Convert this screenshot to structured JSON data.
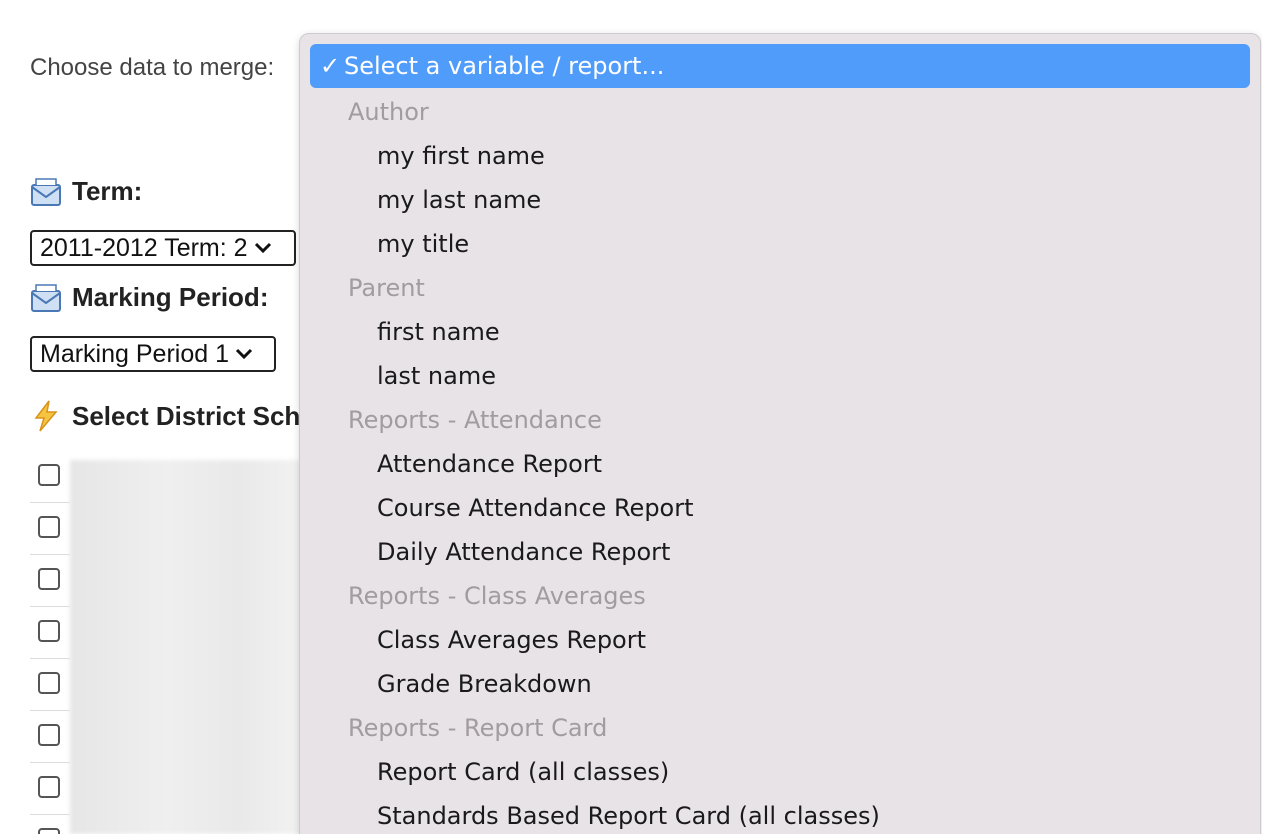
{
  "merge": {
    "label": "Choose data to merge:"
  },
  "term": {
    "heading": "Term:",
    "selected": "2011-2012 Term: 2"
  },
  "marking_period": {
    "heading": "Marking Period:",
    "selected": "Marking Period 1"
  },
  "district": {
    "heading": "Select District School"
  },
  "dropdown": {
    "selected": "Select a variable / report...",
    "check_glyph": "✓",
    "groups": [
      {
        "label": "Author",
        "options": [
          "my first name",
          "my last name",
          "my title"
        ]
      },
      {
        "label": "Parent",
        "options": [
          "first name",
          "last name"
        ]
      },
      {
        "label": "Reports - Attendance",
        "options": [
          "Attendance Report",
          "Course Attendance Report",
          "Daily Attendance Report"
        ]
      },
      {
        "label": "Reports - Class Averages",
        "options": [
          "Class Averages Report",
          "Grade Breakdown"
        ]
      },
      {
        "label": "Reports - Report Card",
        "options": [
          "Report Card (all classes)",
          "Standards Based Report Card (all classes)"
        ]
      }
    ]
  },
  "colors": {
    "highlight": "#4f9cfb",
    "menu_bg": "#e8e3e7",
    "group_text": "#a19ca0"
  }
}
